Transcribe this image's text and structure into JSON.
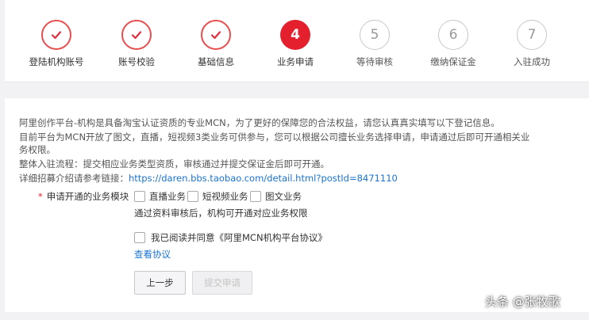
{
  "steps": [
    {
      "label": "登陆机构账号",
      "state": "done"
    },
    {
      "label": "账号校验",
      "state": "done"
    },
    {
      "label": "基础信息",
      "state": "done"
    },
    {
      "number": "4",
      "label": "业务申请",
      "state": "active"
    },
    {
      "number": "5",
      "label": "等待审核",
      "state": "pending"
    },
    {
      "number": "6",
      "label": "缴纳保证金",
      "state": "pending"
    },
    {
      "number": "7",
      "label": "入驻成功",
      "state": "pending"
    }
  ],
  "info": {
    "line1": "阿里创作平台-机构是具备淘宝认证资质的专业MCN，为了更好的保障您的合法权益，请您认真真实填写以下登记信息。",
    "line2": "目前平台为MCN开放了图文，直播，短视频3类业务可供参与，您可以根据公司擅长业务选择申请，申请通过后即可开通相关业务权限。",
    "line3": "整体入驻流程：提交相应业务类型资质，审核通过并提交保证金后即可开通。",
    "link_prefix": "详细招募介绍请参考链接：",
    "link_url": "https://daren.bbs.taobao.com/detail.html?postId=8471110"
  },
  "form": {
    "required_mark": "*",
    "label": "申请开通的业务模块",
    "options": [
      "直播业务",
      "短视频业务",
      "图文业务"
    ],
    "hint": "通过资料审核后，机构可开通对应业务权限",
    "agree_text": "我已阅读并同意《阿里MCN机构平台协议》",
    "view_agreement": "查看协议",
    "prev_button": "上一步",
    "submit_button": "提交申请"
  },
  "watermark": "头条 @张牧歌",
  "colors": {
    "accent": "#e4202e",
    "link": "#1a73d0"
  }
}
